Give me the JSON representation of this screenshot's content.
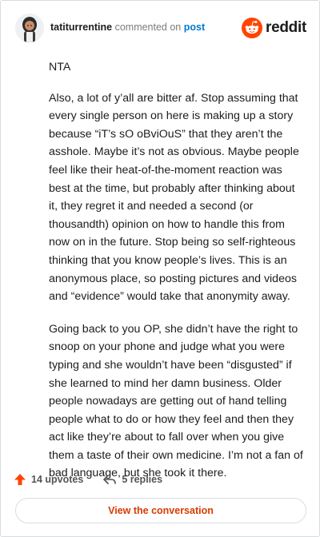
{
  "header": {
    "username": "tatiturrentine",
    "verb": "commented on",
    "post_link": "post",
    "logo_text": "reddit"
  },
  "comment": {
    "paragraphs": [
      "NTA",
      "Also, a lot of y’all are bitter af. Stop assuming that every single person on here is making up a story because “iT’s sO oBviOuS” that they aren’t the asshole. Maybe it’s not as obvious. Maybe people feel like their heat-of-the-moment reaction was best at the time, but probably after thinking about it, they regret it and needed a second (or thousandth) opinion on how to handle this from now on in the future. Stop being so self-righteous thinking that you know people’s lives. This is an anonymous place, so posting pictures and videos and “evidence” would take that anonymity away.",
      "Going back to you OP, she didn’t have the right to snoop on your phone and judge what you were typing and she wouldn’t have been “disgusted” if she learned to mind her damn business. Older people nowadays are getting out of hand telling people what to do or how they feel and then they act like they’re about to fall over when you give them a taste of their own medicine. I’m not a fan of bad language, but she took it there."
    ]
  },
  "footer": {
    "upvotes": "14 upvotes",
    "replies": "5 replies"
  },
  "view_button": "View the conversation",
  "colors": {
    "brand": "#ff4500",
    "link": "#0079d3",
    "button_text": "#d93a00"
  },
  "icons": [
    "avatar",
    "reddit-logo-icon",
    "upvote-icon",
    "reply-icon"
  ]
}
